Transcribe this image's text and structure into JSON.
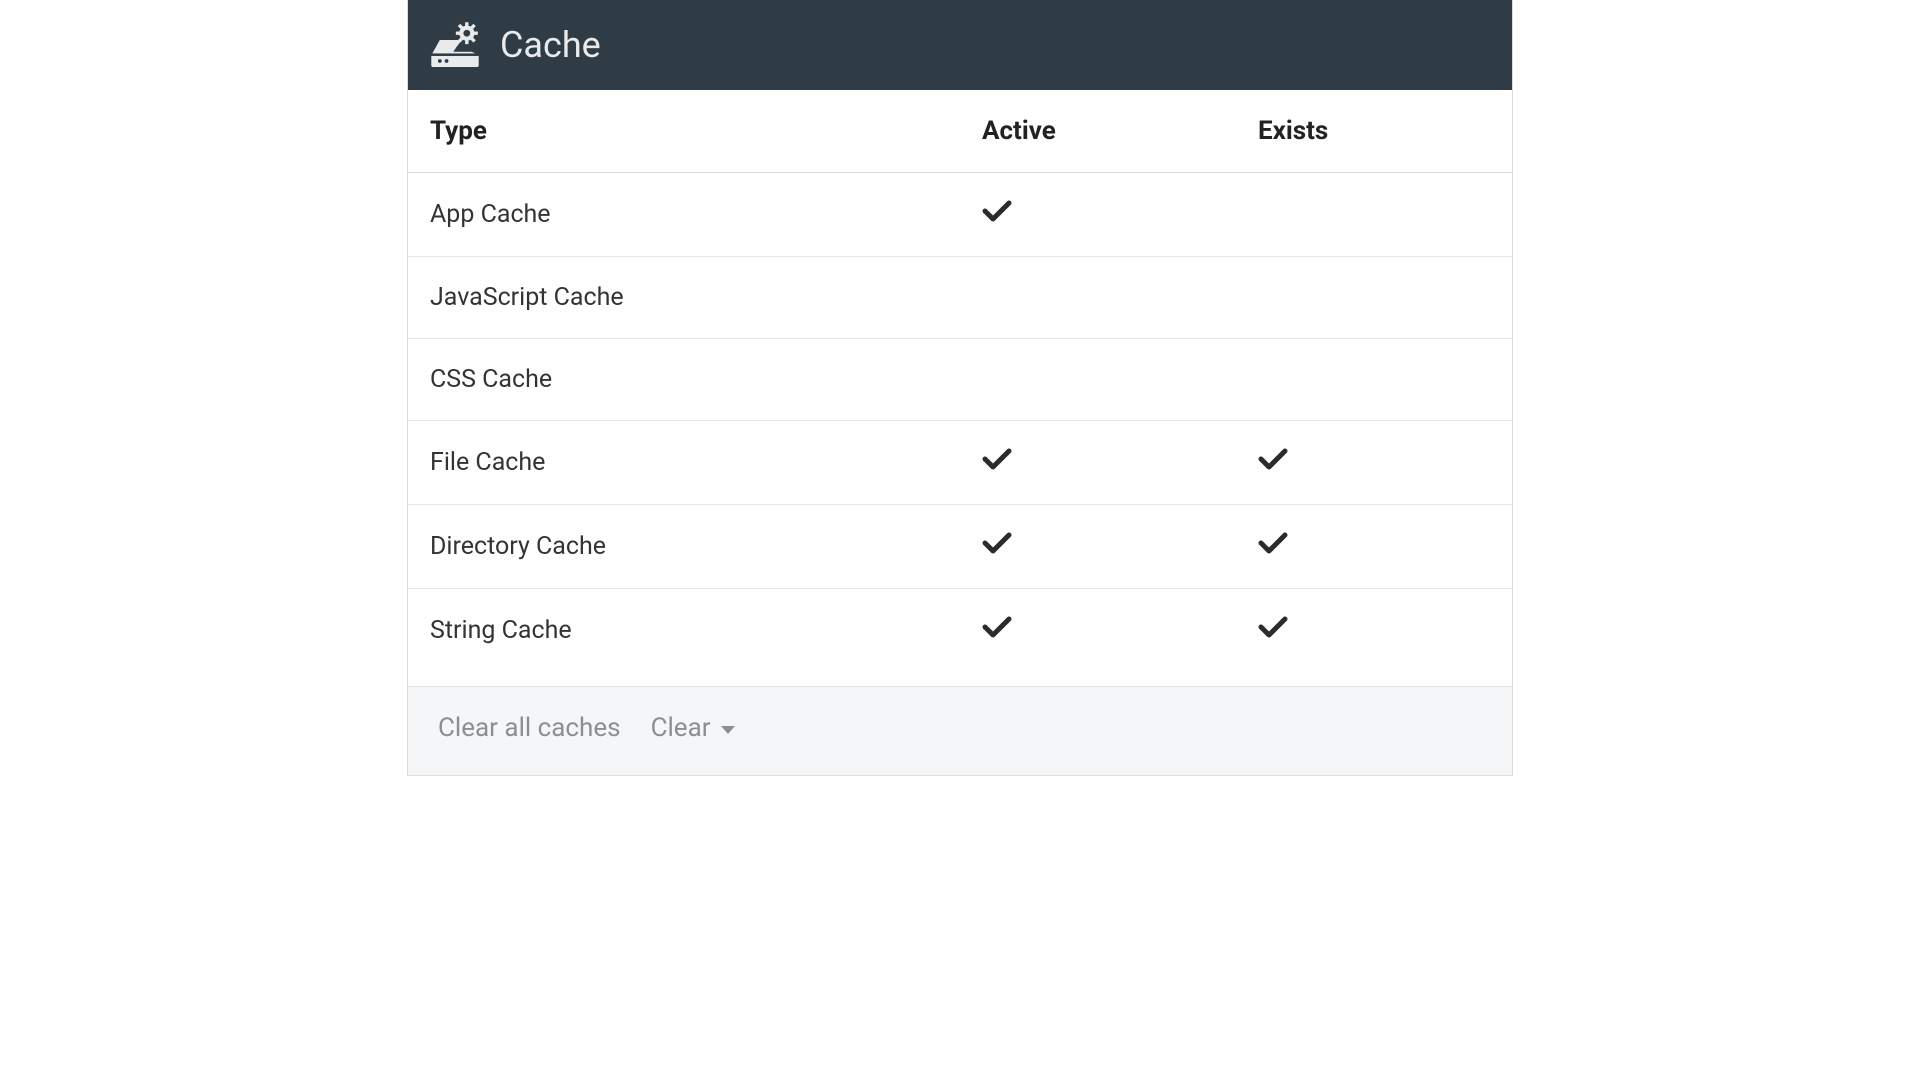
{
  "header": {
    "title": "Cache"
  },
  "table": {
    "columns": {
      "type": "Type",
      "active": "Active",
      "exists": "Exists"
    },
    "rows": [
      {
        "type": "App Cache",
        "active": true,
        "exists": false
      },
      {
        "type": "JavaScript Cache",
        "active": false,
        "exists": false
      },
      {
        "type": "CSS Cache",
        "active": false,
        "exists": false
      },
      {
        "type": "File Cache",
        "active": true,
        "exists": true
      },
      {
        "type": "Directory Cache",
        "active": true,
        "exists": true
      },
      {
        "type": "String Cache",
        "active": true,
        "exists": true
      }
    ]
  },
  "footer": {
    "clear_all_label": "Clear all caches",
    "clear_dropdown_label": "Clear"
  }
}
